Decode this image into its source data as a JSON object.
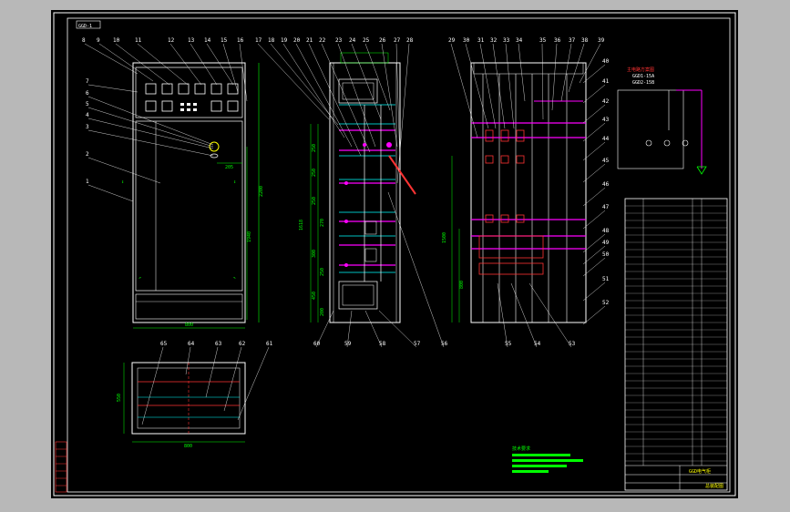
{
  "title_tag": "GGD-1",
  "callouts_top_left": [
    "8",
    "9",
    "10",
    "11",
    "12",
    "13",
    "14",
    "15",
    "16"
  ],
  "callouts_top_mid": [
    "17",
    "18",
    "19",
    "20",
    "21",
    "22",
    "23",
    "24",
    "25",
    "26",
    "27",
    "28"
  ],
  "callouts_top_right": [
    "29",
    "30",
    "31",
    "32",
    "33",
    "34",
    "35",
    "36",
    "37",
    "38",
    "39"
  ],
  "callouts_left": [
    "7",
    "6",
    "5",
    "4",
    "3",
    "2",
    "1"
  ],
  "callouts_right": [
    "40",
    "41",
    "42",
    "43",
    "44",
    "45",
    "46",
    "47",
    "48",
    "49",
    "50",
    "51",
    "52"
  ],
  "callouts_bottom": [
    "60",
    "59",
    "58",
    "57",
    "56",
    "55",
    "54",
    "53"
  ],
  "callouts_plan": [
    "65",
    "64",
    "63",
    "62",
    "61"
  ],
  "dims": {
    "front_width": "800",
    "front_height": "2200",
    "front_inner": "1940",
    "front_meter": "205",
    "side_total": "1618",
    "side_a": "250",
    "side_b": "250",
    "side_c": "250",
    "side_d": "300",
    "side_e": "450",
    "side_f": "250",
    "side_g": "270",
    "side_h": "200",
    "rear_a": "1500",
    "rear_b": "800",
    "plan_w": "800",
    "plan_d": "550"
  },
  "schematic_caption": [
    "主电路方案图",
    "GGD1-15A",
    "GGD2-15B"
  ],
  "notes_header": "技术要求",
  "footer": {
    "stamp": "GGD电气柜",
    "drawing_no": "总装配图"
  },
  "colors": {
    "line": "#ffffff",
    "green": "#00ff00",
    "magenta": "#ff00ff",
    "red": "#ff3333",
    "yellow": "#ffff00",
    "cyan": "#00ffff"
  }
}
